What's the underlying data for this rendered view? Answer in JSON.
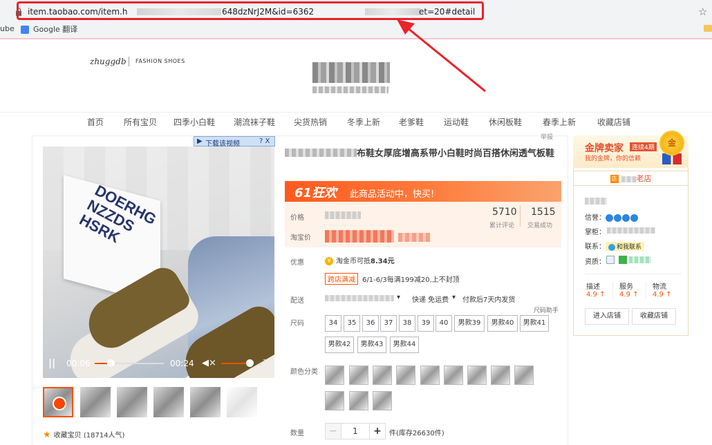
{
  "browser": {
    "url_prefix": "item.taobao.com/item.h",
    "url_middle": "648dzNrJ2M&id=6362",
    "url_suffix": "et=20#detail",
    "bookmarks": [
      "ube",
      "Google 翻译"
    ]
  },
  "shop": {
    "logo": "zhuggdb",
    "logo_sub": "FASHION SHOES"
  },
  "nav": [
    "首页",
    "所有宝贝",
    "四季小白鞋",
    "潮流袜子鞋",
    "尖货热销",
    "冬季上新",
    "老爹鞋",
    "运动鞋",
    "休闲板鞋",
    "春季上新",
    "收藏店铺"
  ],
  "report": "举报",
  "video": {
    "download_tag": "下载该视频",
    "tag_icons": "? X",
    "current_time": "00:06",
    "total_time": "00:24",
    "progress": 0.25,
    "box_text": "DOERHG NZZDS HSRK"
  },
  "favorite": "收藏宝贝 (18714人气)",
  "product": {
    "title_visible": "布鞋女厚底增高系带小白鞋时尚百搭休闲透气板鞋",
    "promo_logo": "61狂欢",
    "promo_text": "此商品活动中，快买!",
    "price_label": "价格",
    "taobao_price_label": "淘宝价",
    "reviews": "5710",
    "reviews_label": "累计评论",
    "deals": "1515",
    "deals_label": "交易成功",
    "discount_label": "优惠",
    "coin_text": "淘金币可抵",
    "coin_amount": "8.34元",
    "cross_store_badge": "跨店满减",
    "cross_store_text": "6/1-6/3每满199减20,上不封顶",
    "delivery_label": "配送",
    "delivery_text": "快递 免运费",
    "ship_text": "付款后7天内发货",
    "size_helper": "尺码助手",
    "size_label": "尺码",
    "sizes": [
      "34",
      "35",
      "36",
      "37",
      "38",
      "39",
      "40",
      "男款39",
      "男款40",
      "男款41"
    ],
    "sizes_row2": [
      "男款42",
      "男款43",
      "男款44"
    ],
    "color_label": "颜色分类",
    "qty_label": "数量",
    "qty": "1",
    "stock": "件(库存26630件)"
  },
  "seller": {
    "gold_title": "金牌卖家",
    "gold_tag": "连续4期",
    "gold_sub": "我的金牌，你的信赖",
    "medal": "金",
    "shop_age": "老店",
    "shop_icon": "店",
    "credit_label": "信誉：",
    "owner_label": "掌柜：",
    "contact_label": "联系：",
    "contact_badge": "和我联系",
    "qualification_label": "资质：",
    "ratings": [
      {
        "label": "描述",
        "value": "4.9 ↑"
      },
      {
        "label": "服务",
        "value": "4.9 ↑"
      },
      {
        "label": "物流",
        "value": "4.9 ↑"
      }
    ],
    "enter_shop": "进入店铺",
    "fav_shop": "收藏店铺"
  },
  "colors": {
    "accent": "#ff5000",
    "highlight": "#e8232a"
  }
}
